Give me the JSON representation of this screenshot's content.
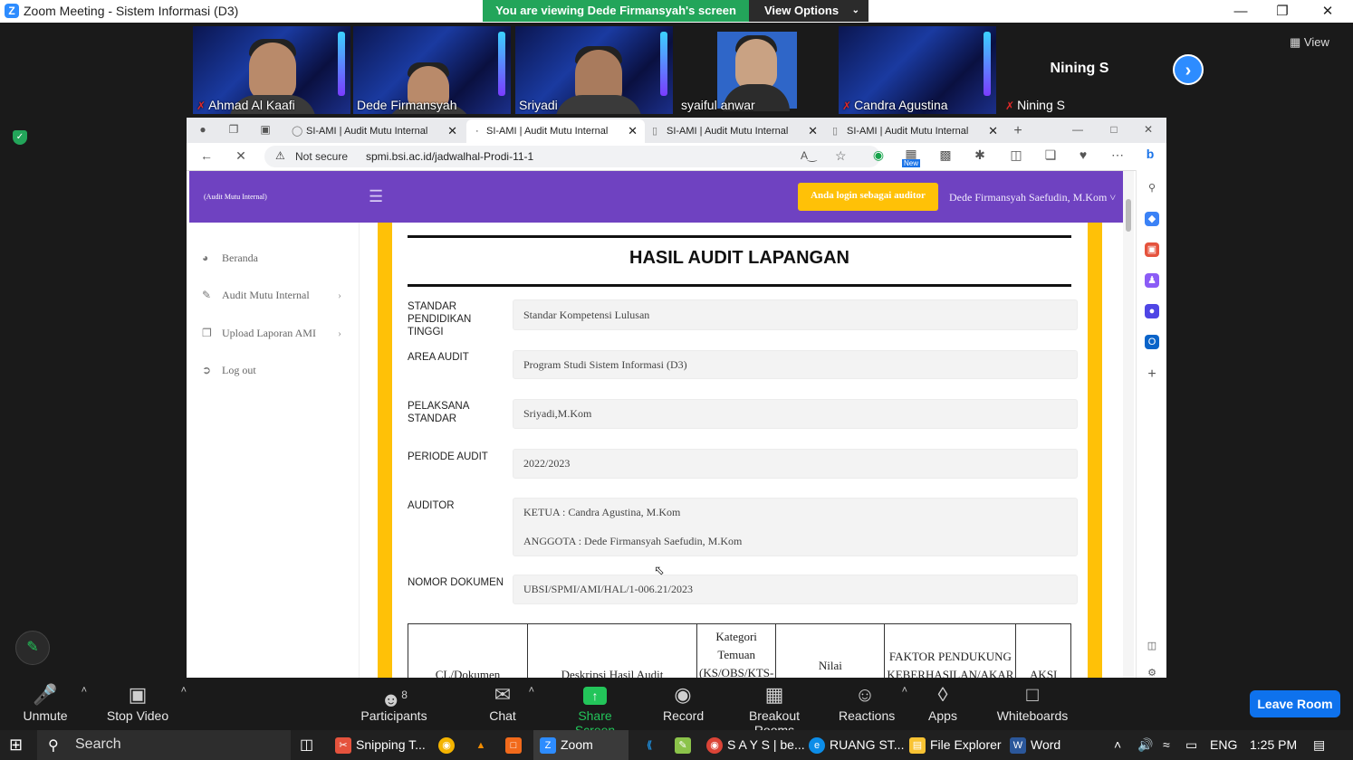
{
  "zoom": {
    "window_title": "Zoom Meeting - Sistem Informasi (D3)",
    "viewing_banner": "You are viewing Dede Firmansyah's screen",
    "view_options": "View Options",
    "view_button": "View",
    "participants": [
      {
        "name": "Ahmad Al Kaafi",
        "muted": true
      },
      {
        "name": "Dede Firmansyah",
        "muted": false
      },
      {
        "name": "Sriyadi",
        "muted": false
      },
      {
        "name": "syaiful anwar",
        "muted": false
      },
      {
        "name": "Candra Agustina",
        "muted": true
      },
      {
        "name": "Nining S",
        "muted": true
      }
    ],
    "nining_big_name": "Nining S",
    "toolbar": {
      "unmute": "Unmute",
      "stop_video": "Stop Video",
      "participants": "Participants",
      "participants_count": "8",
      "chat": "Chat",
      "share_screen": "Share Screen",
      "record": "Record",
      "breakout_rooms": "Breakout Rooms",
      "reactions": "Reactions",
      "apps": "Apps",
      "whiteboards": "Whiteboards",
      "leave_room": "Leave Room"
    }
  },
  "browser": {
    "tabs": [
      {
        "title": "SI-AMI | Audit Mutu Internal",
        "active": false
      },
      {
        "title": "SI-AMI | Audit Mutu Internal",
        "active": true
      },
      {
        "title": "SI-AMI | Audit Mutu Internal",
        "active": false
      },
      {
        "title": "SI-AMI | Audit Mutu Internal",
        "active": false
      }
    ],
    "security": "Not secure",
    "url": "spmi.bsi.ac.id/jadwalhal-Prodi-11-1",
    "new_badge": "New"
  },
  "site": {
    "brand": "(Audit Mutu Internal)",
    "login_badge": "Anda login sebagai auditor",
    "user_name": "Dede Firmansyah Saefudin, M.Kom",
    "sidebar": [
      {
        "label": "Beranda",
        "icon": "dashboard-icon",
        "has_submenu": false
      },
      {
        "label": "Audit Mutu Internal",
        "icon": "edit-icon",
        "has_submenu": true
      },
      {
        "label": "Upload Laporan AMI",
        "icon": "copy-icon",
        "has_submenu": true
      },
      {
        "label": "Log out",
        "icon": "logout-icon",
        "has_submenu": false
      }
    ],
    "page_title": "HASIL AUDIT LAPANGAN",
    "fields": {
      "standar_label": "STANDAR PENDIDIKAN TINGGI",
      "standar_value": "Standar Kompetensi Lulusan",
      "area_label": "AREA AUDIT",
      "area_value": "Program Studi Sistem Informasi (D3)",
      "pelaksana_label": "PELAKSANA STANDAR",
      "pelaksana_value": "Sriyadi,M.Kom",
      "periode_label": "PERIODE AUDIT",
      "periode_value": "2022/2023",
      "auditor_label": "AUDITOR",
      "auditor_ketua": "KETUA : Candra Agustina, M.Kom",
      "auditor_anggota": "ANGGOTA : Dede Firmansyah Saefudin, M.Kom",
      "nomor_label": "NOMOR DOKUMEN",
      "nomor_value": "UBSI/SPMI/AMI/HAL/1-006.21/2023"
    },
    "table_headers": [
      "CL/Dokumen",
      "Deskripsi Hasil Audit",
      "Kategori Temuan (KS/OBS/KTS-",
      "Nilai",
      "FAKTOR PENDUKUNG KEBERHASILAN/AKAR",
      "AKSI"
    ]
  },
  "taskbar": {
    "search": "Search",
    "items": [
      "Snipping T...",
      "Zoom",
      "S A Y S | be...",
      "RUANG ST...",
      "File Explorer",
      "Word"
    ],
    "lang": "ENG",
    "time": "1:25 PM"
  }
}
